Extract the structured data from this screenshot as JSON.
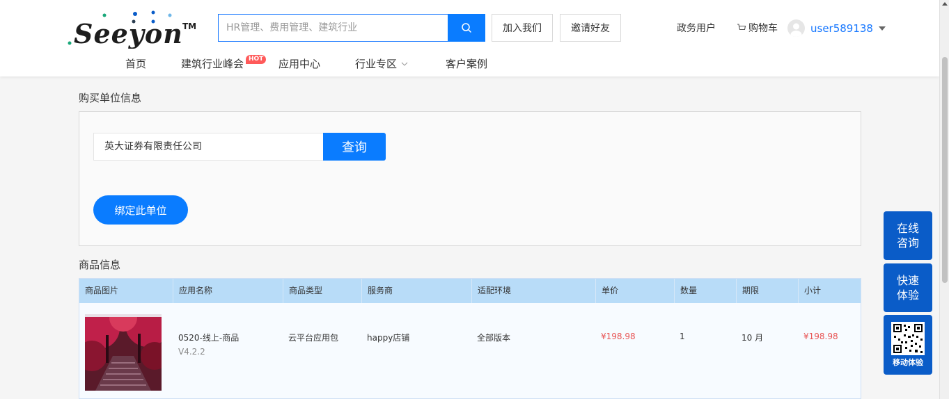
{
  "header": {
    "logo_text": "Seeyon",
    "logo_tm": "TM",
    "search_placeholder": "HR管理、费用管理、建筑行业",
    "join_label": "加入我们",
    "invite_label": "邀请好友",
    "gov_label": "政务用户",
    "cart_label": "购物车",
    "username": "user589138"
  },
  "nav": {
    "home": "首页",
    "summit": "建筑行业峰会",
    "hot": "HOT",
    "app_center": "应用中心",
    "industry": "行业专区",
    "cases": "客户案例"
  },
  "buyer": {
    "title": "购买单位信息",
    "company_value": "英大证券有限责任公司",
    "query_label": "查询",
    "bind_label": "绑定此单位"
  },
  "product": {
    "title": "商品信息",
    "columns": [
      "商品图片",
      "应用名称",
      "商品类型",
      "服务商",
      "适配环境",
      "单价",
      "数量",
      "期限",
      "小计"
    ],
    "row": {
      "name": "0520-线上-商品",
      "version": "V4.2.2",
      "type": "云平台应用包",
      "vendor": "happy店铺",
      "env": "全部版本",
      "price": "¥198.98",
      "qty": "1",
      "period": "10 月",
      "subtotal": "¥198.98"
    }
  },
  "float": {
    "consult": "在线\n咨询",
    "consult_1": "在线",
    "consult_2": "咨询",
    "trial_1": "快速",
    "trial_2": "体验",
    "mobile": "移动体验"
  },
  "colors": {
    "accent": "#0a7cff",
    "float_bg": "#0a5cc8",
    "price_red": "#e85454",
    "table_head": "#b8dcf8",
    "hot": "#ff5a5a"
  }
}
